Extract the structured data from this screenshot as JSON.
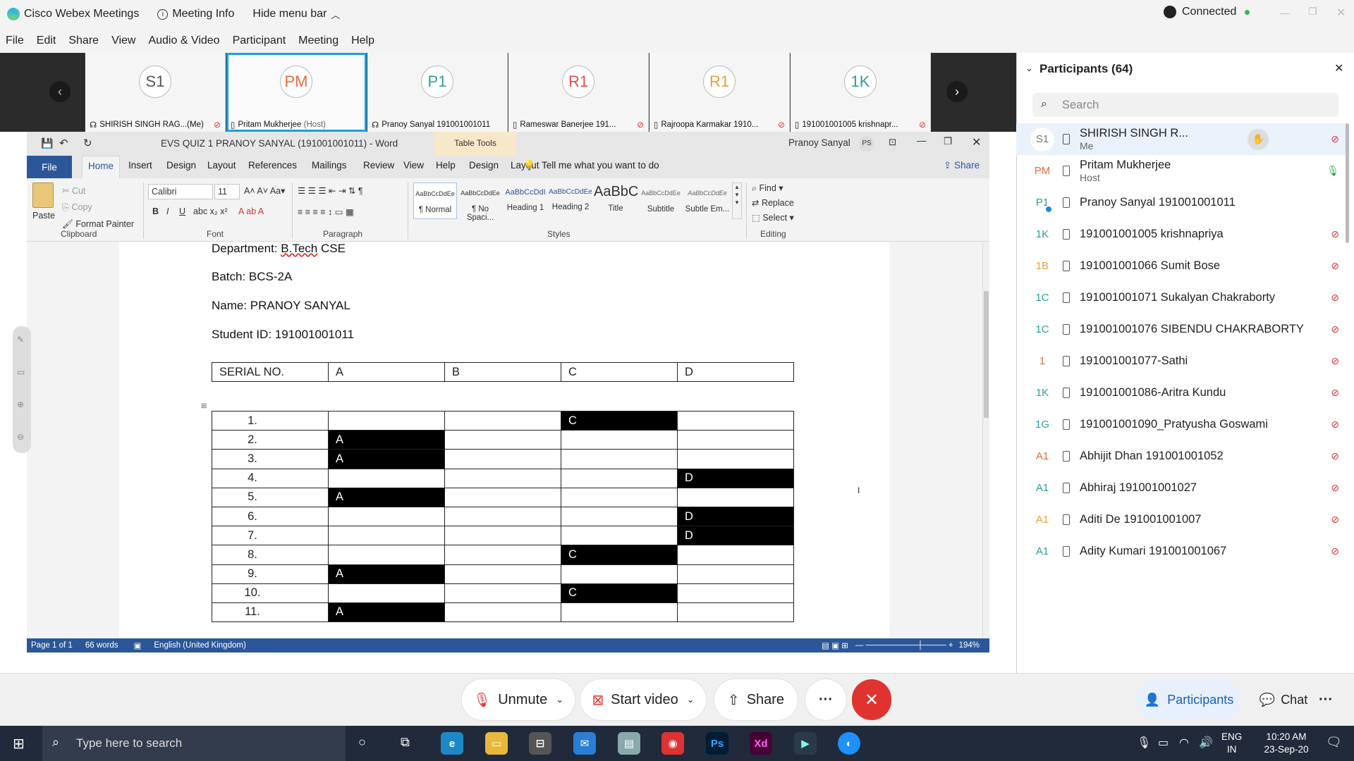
{
  "app": {
    "title": "Cisco Webex Meetings",
    "meeting_info": "Meeting Info",
    "hide_menu": "Hide menu bar",
    "status": "Connected"
  },
  "menu": [
    "File",
    "Edit",
    "Share",
    "View",
    "Audio & Video",
    "Participant",
    "Meeting",
    "Help"
  ],
  "video_strip": [
    {
      "initials": "S1",
      "name": "SHIRISH SINGH RAG...(Me)",
      "color": "#666666"
    },
    {
      "initials": "PM",
      "name": "Pritam  Mukherjee",
      "sub": "(Host)",
      "color": "#e46a3d"
    },
    {
      "initials": "P1",
      "name": "Pranoy Sanyal 191001001011",
      "color": "#2aa198"
    },
    {
      "initials": "R1",
      "name": "Rameswar Banerjee 191...",
      "color": "#e0504a"
    },
    {
      "initials": "R1",
      "name": "Rajroopa Karmakar 1910...",
      "color": "#e6a23c"
    },
    {
      "initials": "1K",
      "name": "191001001005 krishnapr...",
      "color": "#2aa198"
    }
  ],
  "word": {
    "title": "EVS QUIZ 1  PRANOY SANYAL (191001001011)  -  Word",
    "table_tools": "Table Tools",
    "user": "Pranoy Sanyal",
    "user_initials": "PS",
    "tabs": [
      "File",
      "Home",
      "Insert",
      "Design",
      "Layout",
      "References",
      "Mailings",
      "Review",
      "View",
      "Help",
      "Design",
      "Layout"
    ],
    "tell_me": "Tell me what you want to do",
    "share": "Share",
    "clipboard": {
      "paste": "Paste",
      "cut": "Cut",
      "copy": "Copy",
      "format_painter": "Format Painter",
      "label": "Clipboard"
    },
    "font": {
      "name": "Calibri",
      "size": "11",
      "label": "Font"
    },
    "paragraph_label": "Paragraph",
    "styles": [
      {
        "preview": "AaBbCcDdEe",
        "name": "¶ Normal"
      },
      {
        "preview": "AaBbCcDdEe",
        "name": "¶ No Spaci..."
      },
      {
        "preview": "AaBbCcDdI",
        "name": "Heading 1"
      },
      {
        "preview": "AaBbCcDdEe",
        "name": "Heading 2"
      },
      {
        "preview": "AaBbC",
        "name": "Title"
      },
      {
        "preview": "AaBbCcDdEe",
        "name": "Subtitle"
      },
      {
        "preview": "AaBbCcDdEe",
        "name": "Subtle Em..."
      }
    ],
    "styles_label": "Styles",
    "editing": {
      "find": "Find",
      "replace": "Replace",
      "select": "Select",
      "label": "Editing"
    },
    "doc": {
      "department_label": "Department: ",
      "department_value": "B.Tech",
      "department_rest": " CSE",
      "batch": "Batch: BCS-2A",
      "name": "Name: PRANOY SANYAL",
      "student_id": "Student ID: 191001001011",
      "header": [
        "SERIAL NO.",
        "A",
        "B",
        "C",
        "D"
      ],
      "answers": [
        {
          "n": "1.",
          "ans": "C"
        },
        {
          "n": "2.",
          "ans": "A"
        },
        {
          "n": "3.",
          "ans": "A"
        },
        {
          "n": "4.",
          "ans": "D"
        },
        {
          "n": "5.",
          "ans": "A"
        },
        {
          "n": "6.",
          "ans": "D"
        },
        {
          "n": "7.",
          "ans": "D"
        },
        {
          "n": "8.",
          "ans": "C"
        },
        {
          "n": "9.",
          "ans": "A"
        },
        {
          "n": "10.",
          "ans": "C"
        },
        {
          "n": "11.",
          "ans": "A"
        }
      ]
    },
    "status": {
      "page": "Page 1 of 1",
      "words": "66 words",
      "language": "English (United Kingdom)",
      "zoom": "194%"
    }
  },
  "participants": {
    "title": "Participants (64)",
    "search_placeholder": "Search",
    "list": [
      {
        "initials": "S1",
        "name": "SHIRISH SINGH R...",
        "sub": "Me",
        "color": "#777777",
        "mic": "off"
      },
      {
        "initials": "PM",
        "name": "Pritam  Mukherjee",
        "sub": "Host",
        "color": "#e46a3d",
        "mic": "on"
      },
      {
        "initials": "P1",
        "name": "Pranoy Sanyal 191001001011",
        "color": "#2aa198",
        "mic": "none"
      },
      {
        "initials": "1K",
        "name": "191001001005 krishnapriya",
        "color": "#2aa198",
        "mic": "off"
      },
      {
        "initials": "1B",
        "name": "191001001066 Sumit Bose",
        "color": "#e6a23c",
        "mic": "off"
      },
      {
        "initials": "1C",
        "name": "191001001071 Sukalyan Chakraborty",
        "color": "#2aa198",
        "mic": "off"
      },
      {
        "initials": "1C",
        "name": "191001001076 SIBENDU CHAKRABORTY",
        "color": "#2aa198",
        "mic": "off"
      },
      {
        "initials": "1",
        "name": "191001001077-Sathi",
        "color": "#e46a3d",
        "mic": "off"
      },
      {
        "initials": "1K",
        "name": "191001001086-Aritra Kundu",
        "color": "#2aa198",
        "mic": "off"
      },
      {
        "initials": "1G",
        "name": "191001001090_Pratyusha Goswami",
        "color": "#2aa198",
        "mic": "off"
      },
      {
        "initials": "A1",
        "name": "Abhijit Dhan 191001001052",
        "color": "#e46a3d",
        "mic": "off"
      },
      {
        "initials": "A1",
        "name": "Abhiraj 191001001027",
        "color": "#2aa198",
        "mic": "off"
      },
      {
        "initials": "A1",
        "name": "Aditi De 191001001007",
        "color": "#e6a23c",
        "mic": "off"
      },
      {
        "initials": "A1",
        "name": "Adity Kumari 191001001067",
        "color": "#2aa198",
        "mic": "off"
      }
    ]
  },
  "controls": {
    "unmute": "Unmute",
    "start_video": "Start video",
    "share": "Share",
    "more": "···",
    "participants": "Participants",
    "chat": "Chat"
  },
  "taskbar": {
    "search_placeholder": "Type here to search",
    "lang1": "ENG",
    "lang2": "IN",
    "time": "10:20 AM",
    "date": "23-Sep-20"
  }
}
